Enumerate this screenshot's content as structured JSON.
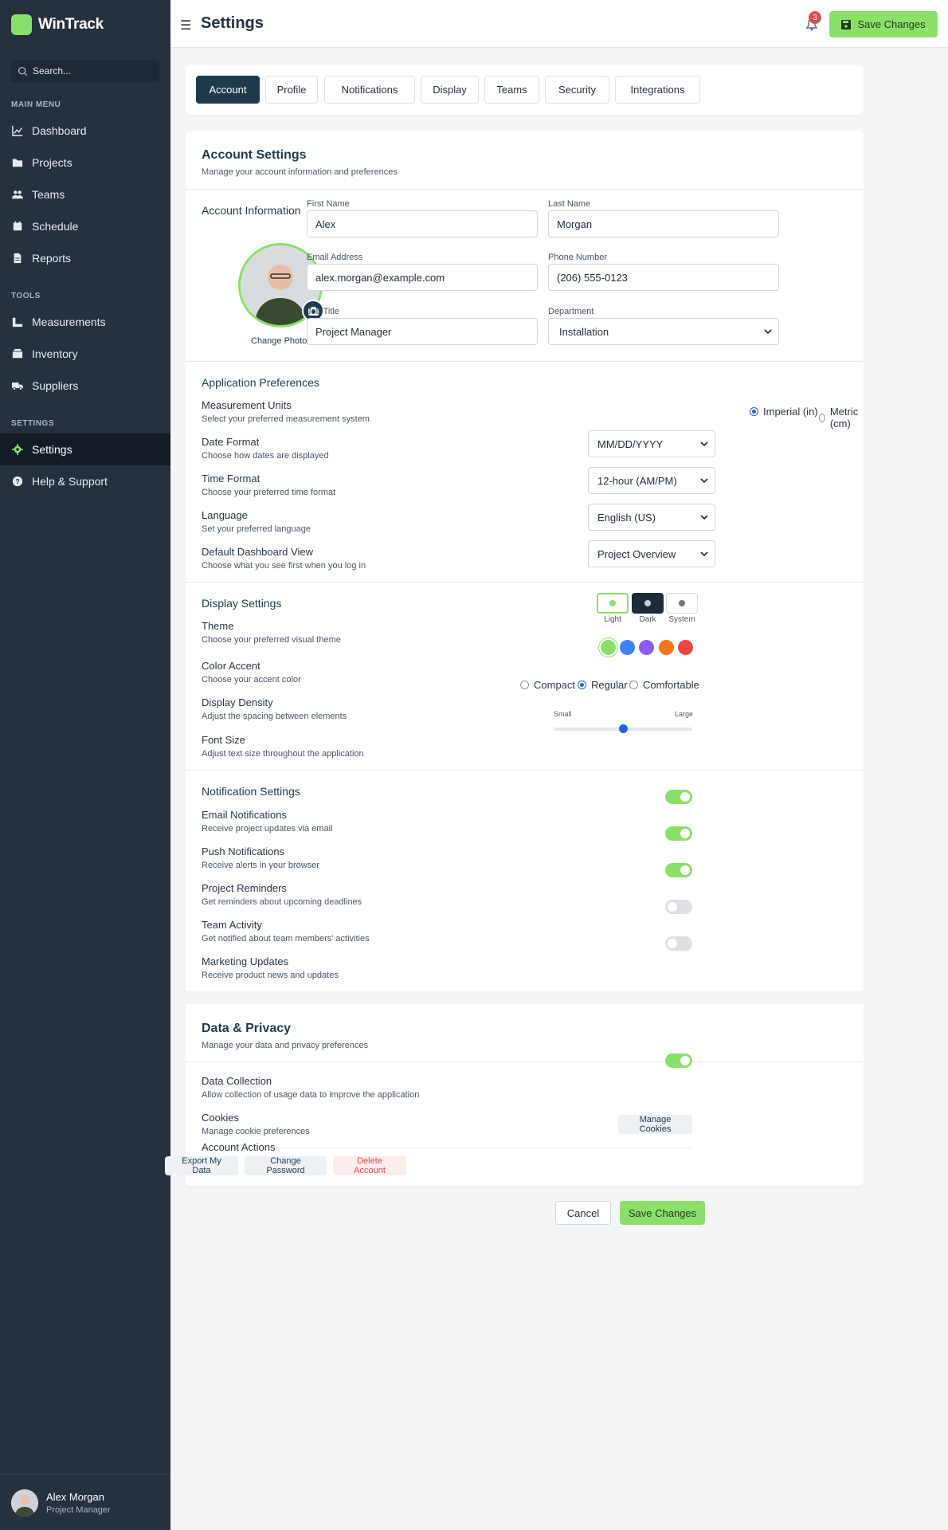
{
  "app": {
    "name": "WinTrack"
  },
  "sidebar": {
    "search_placeholder": "Search...",
    "sections": {
      "main": "MAIN MENU",
      "tools": "TOOLS",
      "settings": "SETTINGS"
    },
    "items": [
      {
        "label": "Dashboard",
        "icon": "chart-line-icon"
      },
      {
        "label": "Projects",
        "icon": "folder-icon"
      },
      {
        "label": "Teams",
        "icon": "users-icon"
      },
      {
        "label": "Schedule",
        "icon": "calendar-icon"
      },
      {
        "label": "Reports",
        "icon": "file-icon"
      },
      {
        "label": "Measurements",
        "icon": "ruler-icon"
      },
      {
        "label": "Inventory",
        "icon": "box-icon"
      },
      {
        "label": "Suppliers",
        "icon": "truck-icon"
      },
      {
        "label": "Settings",
        "icon": "gear-icon",
        "active": true
      },
      {
        "label": "Help & Support",
        "icon": "question-icon"
      }
    ],
    "user": {
      "name": "Alex Morgan",
      "role": "Project Manager"
    }
  },
  "header": {
    "title": "Settings",
    "notification_count": "3",
    "save_label": "Save Changes"
  },
  "tabs": [
    "Account",
    "Profile",
    "Notifications",
    "Display",
    "Teams",
    "Security",
    "Integrations"
  ],
  "account": {
    "title": "Account Settings",
    "subtitle": "Manage your account information and preferences",
    "info_heading": "Account Information",
    "change_photo": "Change Photo",
    "fields": {
      "first_name": {
        "label": "First Name",
        "value": "Alex"
      },
      "last_name": {
        "label": "Last Name",
        "value": "Morgan"
      },
      "email": {
        "label": "Email Address",
        "value": "alex.morgan@example.com"
      },
      "phone": {
        "label": "Phone Number",
        "value": "(206) 555-0123"
      },
      "job_title": {
        "label": "Job Title",
        "value": "Project Manager"
      },
      "department": {
        "label": "Department",
        "value": "Installation"
      }
    }
  },
  "preferences": {
    "heading": "Application Preferences",
    "units": {
      "label": "Measurement Units",
      "desc": "Select your preferred measurement system",
      "opt1": "Imperial (in)",
      "opt2": "Metric (cm)",
      "selected": "Imperial (in)"
    },
    "date": {
      "label": "Date Format",
      "desc": "Choose how dates are displayed",
      "value": "MM/DD/YYYY"
    },
    "time": {
      "label": "Time Format",
      "desc": "Choose your preferred time format",
      "value": "12-hour (AM/PM)"
    },
    "language": {
      "label": "Language",
      "desc": "Set your preferred language",
      "value": "English (US)"
    },
    "dashboard": {
      "label": "Default Dashboard View",
      "desc": "Choose what you see first when you log in",
      "value": "Project Overview"
    }
  },
  "display": {
    "heading": "Display Settings",
    "theme": {
      "label": "Theme",
      "desc": "Choose your preferred visual theme",
      "light": "Light",
      "dark": "Dark",
      "system": "System",
      "selected": "Light"
    },
    "accent": {
      "label": "Color Accent",
      "desc": "Choose your accent color",
      "colors": [
        "#8be06a",
        "#3b82f6",
        "#8b5cf6",
        "#f97316",
        "#ef4444"
      ],
      "selected": "#8be06a"
    },
    "density": {
      "label": "Display Density",
      "desc": "Adjust the spacing between elements",
      "opt1": "Compact",
      "opt2": "Regular",
      "opt3": "Comfortable",
      "selected": "Regular"
    },
    "font": {
      "label": "Font Size",
      "desc": "Adjust text size throughout the application",
      "small": "Small",
      "large": "Large",
      "level": 0.5
    }
  },
  "notifications": {
    "heading": "Notification Settings",
    "items": [
      {
        "label": "Email Notifications",
        "desc": "Receive project updates via email",
        "on": true
      },
      {
        "label": "Push Notifications",
        "desc": "Receive alerts in your browser",
        "on": true
      },
      {
        "label": "Project Reminders",
        "desc": "Get reminders about upcoming deadlines",
        "on": true
      },
      {
        "label": "Team Activity",
        "desc": "Get notified about team members' activities",
        "on": false
      },
      {
        "label": "Marketing Updates",
        "desc": "Receive product news and updates",
        "on": false
      }
    ]
  },
  "privacy": {
    "title": "Data & Privacy",
    "subtitle": "Manage your data and privacy preferences",
    "data_collection": {
      "label": "Data Collection",
      "desc": "Allow collection of usage data to improve the application",
      "on": true
    },
    "cookies": {
      "label": "Cookies",
      "desc": "Manage cookie preferences",
      "button": "Manage Cookies"
    },
    "actions": {
      "heading": "Account Actions",
      "export": "Export My Data",
      "password": "Change Password",
      "delete": "Delete Account"
    }
  },
  "footer": {
    "cancel": "Cancel",
    "save": "Save Changes"
  }
}
